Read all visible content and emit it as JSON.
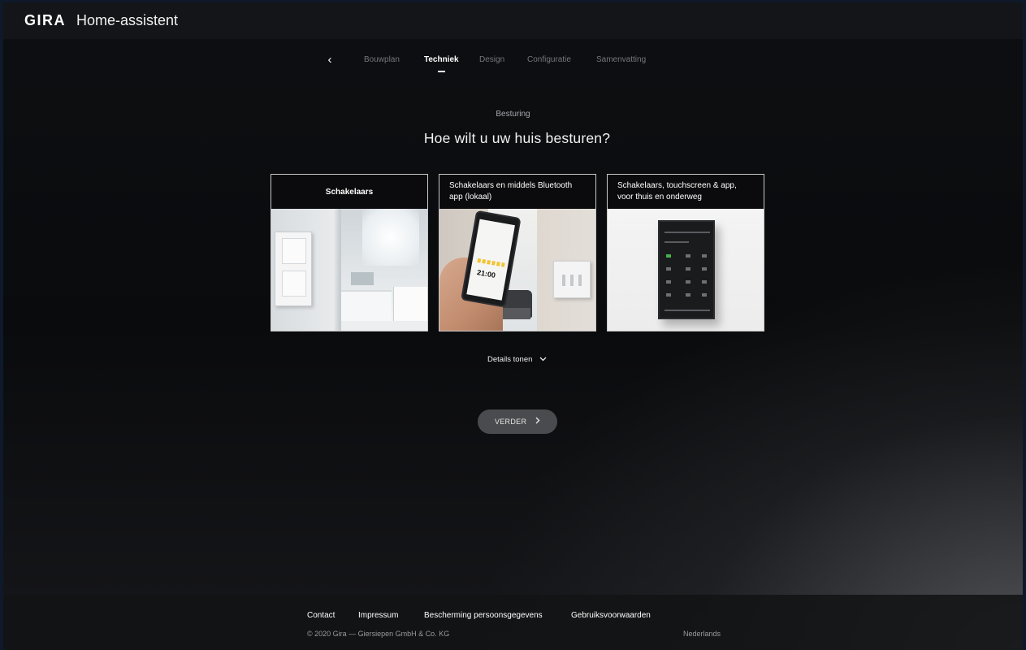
{
  "header": {
    "logo": "GIRA",
    "title": "Home-assistent"
  },
  "nav": {
    "back_glyph": "‹",
    "steps": [
      {
        "label": "Bouwplan",
        "active": false
      },
      {
        "label": "Techniek",
        "active": true
      },
      {
        "label": "Design",
        "active": false
      },
      {
        "label": "Configuratie",
        "active": false
      },
      {
        "label": "Samenvatting",
        "active": false
      }
    ]
  },
  "section": {
    "overline": "Besturing",
    "heading": "Hoe wilt u uw huis besturen?"
  },
  "cards": [
    {
      "label": "Schakelaars",
      "image": "bathroom-switch-photo"
    },
    {
      "label": "Schakelaars en middels Bluetooth app (lokaal)",
      "image": "phone-app-photo",
      "phone_time": "21:00"
    },
    {
      "label": "Schakelaars, touchscreen & app, voor thuis en onderweg",
      "image": "touch-panel-photo"
    }
  ],
  "details": {
    "label": "Details tonen",
    "icon": "chevron-down-icon"
  },
  "continue_button": {
    "label": "VERDER",
    "icon": "chevron-right-icon"
  },
  "footer": {
    "links": [
      "Contact",
      "Impressum",
      "Bescherming persoonsgegevens",
      "Gebruiksvoorwaarden"
    ],
    "copyright": "© 2020 Gira — Giersiepen GmbH & Co. KG",
    "language": "Nederlands"
  },
  "colors": {
    "background": "#0c0d10",
    "header_bg": "#141518",
    "button_bg": "#4a4b4e",
    "card_border": "#c9c9c9"
  }
}
